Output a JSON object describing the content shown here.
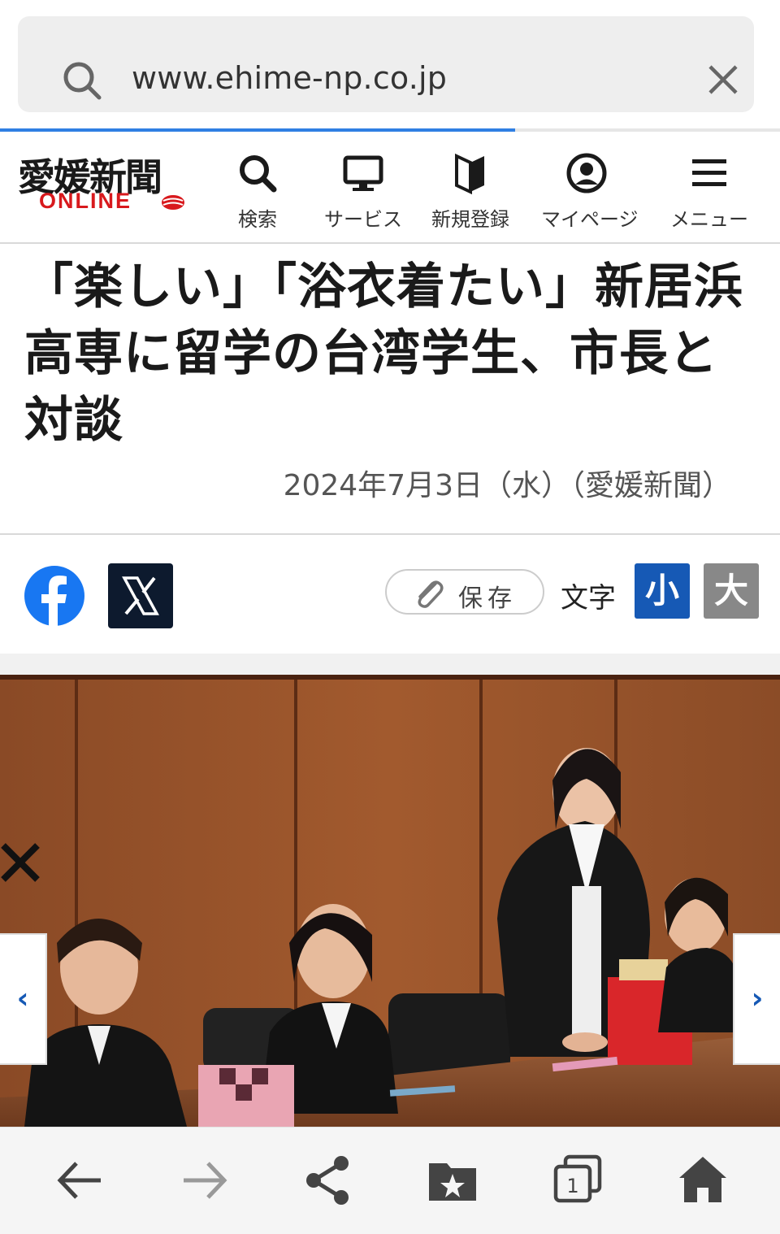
{
  "browser": {
    "url": "www.ehime-np.co.jp",
    "load_progress": 0.66,
    "icons": {
      "search": "search-icon",
      "clear": "close-icon"
    },
    "bottom_nav": [
      {
        "name": "back",
        "icon": "arrow-left-icon"
      },
      {
        "name": "forward",
        "icon": "arrow-right-icon"
      },
      {
        "name": "share",
        "icon": "share-icon"
      },
      {
        "name": "bookmarks",
        "icon": "bookmark-folder-icon"
      },
      {
        "name": "tabs",
        "icon": "tabs-icon",
        "count": "1"
      },
      {
        "name": "home",
        "icon": "home-icon"
      }
    ]
  },
  "site": {
    "logo_jp": "愛媛新聞",
    "logo_en": "ONLINE",
    "nav": [
      {
        "label": "検索",
        "icon": "search-icon"
      },
      {
        "label": "サービス",
        "icon": "monitor-icon"
      },
      {
        "label": "新規登録",
        "icon": "beginner-mark-icon"
      },
      {
        "label": "マイページ",
        "icon": "user-icon"
      },
      {
        "label": "メニュー",
        "icon": "hamburger-icon"
      }
    ],
    "brand_color": "#d8191d",
    "accent_color": "#1659b5"
  },
  "article": {
    "title": "「楽しい」「浴衣着たい」新居浜高専に留学の台湾学生、市長と対談",
    "date": "2024年7月3日（水）（愛媛新聞）"
  },
  "toolbar": {
    "save_label": "保存",
    "font_label": "文字",
    "font_small": "小",
    "font_large": "大",
    "share_icons": [
      "facebook-icon",
      "x-icon"
    ]
  },
  "photo": {
    "prev_label": "‹",
    "next_label": "›",
    "close_icon": "close-icon"
  }
}
